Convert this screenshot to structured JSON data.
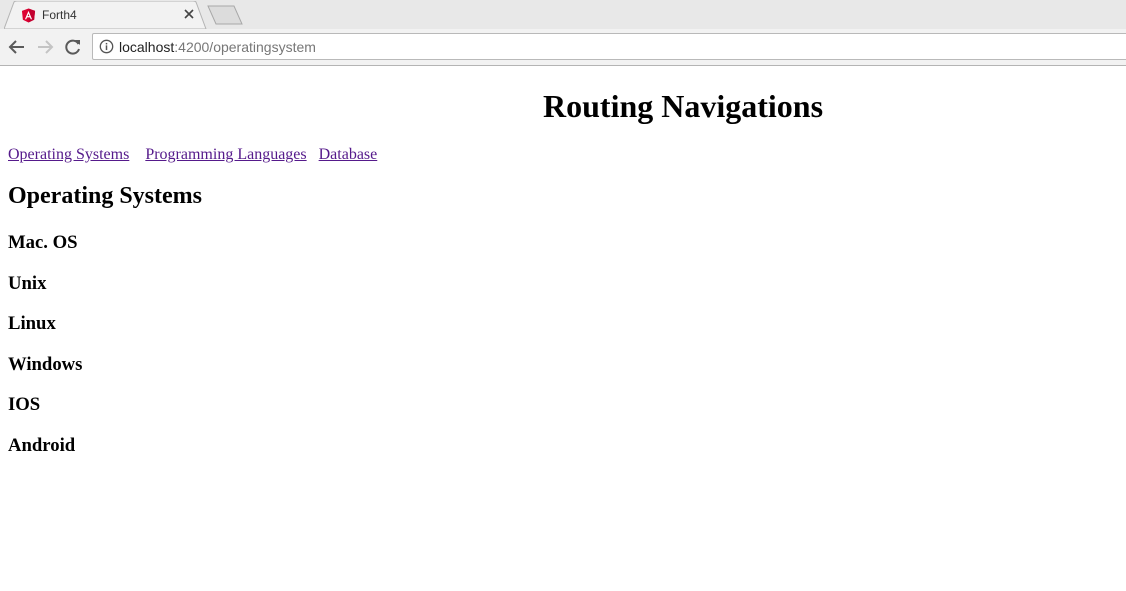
{
  "browser": {
    "tab": {
      "title": "Forth4"
    },
    "address_bar": {
      "host": "localhost",
      "path": ":4200/operatingsystem"
    }
  },
  "page": {
    "title": "Routing Navigations",
    "nav_links": [
      {
        "label": "Operating Systems"
      },
      {
        "label": "Programming Languages"
      },
      {
        "label": "Database"
      }
    ],
    "section_heading": "Operating Systems",
    "operating_systems": [
      "Mac. OS",
      "Unix",
      "Linux",
      "Windows",
      "IOS",
      "Android"
    ]
  },
  "icons": {
    "favicon": "angular-logo-icon",
    "close": "close-icon",
    "back": "back-arrow-icon",
    "forward": "forward-arrow-icon",
    "reload": "reload-icon",
    "info": "info-icon"
  },
  "colors": {
    "visited_link": "#551a8b",
    "angular_red": "#dd0031"
  }
}
